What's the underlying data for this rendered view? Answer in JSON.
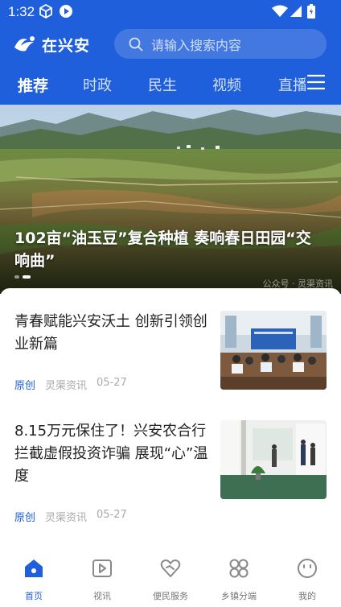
{
  "status_bar": {
    "time": "1:32"
  },
  "header": {
    "logo_text": "在兴安",
    "search_placeholder": "请输入搜索内容",
    "tabs": [
      {
        "label": "推荐",
        "active": true
      },
      {
        "label": "时政",
        "active": false
      },
      {
        "label": "民生",
        "active": false
      },
      {
        "label": "视频",
        "active": false
      },
      {
        "label": "直播",
        "active": false
      }
    ]
  },
  "banner": {
    "title": "102亩“油玉豆”复合种植 奏响春日田园“交响曲”",
    "watermark": "公众号 · 灵渠资讯",
    "slide_count": 2,
    "active_slide": 1
  },
  "articles": [
    {
      "title": "青春赋能兴安沃土 创新引领创业新篇",
      "tag": "原创",
      "source": "灵渠资讯",
      "date": "05-27",
      "thumb": "meeting-room-photo"
    },
    {
      "title": "8.15万元保住了！兴安农合行拦截虚假投资诈骗 展现“心”温度",
      "tag": "原创",
      "source": "灵渠资讯",
      "date": "05-27",
      "thumb": "bank-counter-photo"
    }
  ],
  "tab_bar": [
    {
      "label": "首页",
      "icon": "home-icon",
      "active": true
    },
    {
      "label": "视讯",
      "icon": "video-icon",
      "active": false
    },
    {
      "label": "便民服务",
      "icon": "heart-service-icon",
      "active": false
    },
    {
      "label": "乡镇分端",
      "icon": "grid-clover-icon",
      "active": false
    },
    {
      "label": "我的",
      "icon": "profile-smile-icon",
      "active": false
    }
  ],
  "colors": {
    "brand": "#1f5fdc",
    "tag": "#1f5fdc",
    "meta": "#aaaaaa"
  }
}
